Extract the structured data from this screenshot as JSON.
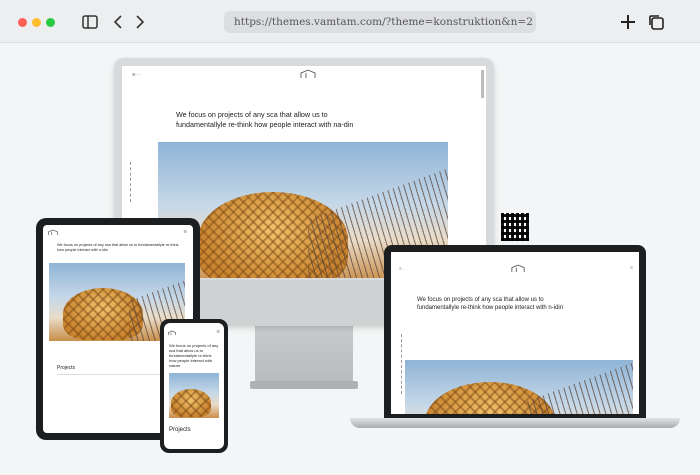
{
  "browser": {
    "url": "https://themes.vamtam.com/?theme=konstruktion&n=2",
    "traffic_colors": [
      "#fe5f57",
      "#febc2e",
      "#28c840"
    ]
  },
  "site": {
    "headline_line1": "We focus on projects of any sca that allow us to",
    "headline_line2": "fundamentallyle re-think how people interact with na-din",
    "laptop_line1": "We focus on projects of any sca that allow us to",
    "laptop_line2": "fundamentallyle re-think how people interact with n-idin",
    "tablet_headline": "We focus on projects of any sca that allow us to fundamentallyle re-think how people interact with n-idin",
    "phone_headline": "We focus on projects of any sca that allow us to fundamentallyle re-think how people interact with nature",
    "projects_label": "Projects"
  }
}
